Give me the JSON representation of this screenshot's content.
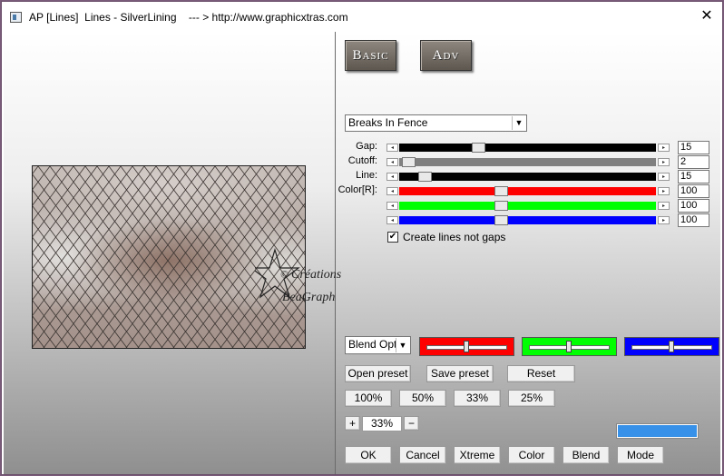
{
  "window": {
    "title": "AP [Lines]  Lines - SilverLining    --- > http://www.graphicxtras.com",
    "close_glyph": "✕",
    "app_icon": "window-app-icon"
  },
  "mode_buttons": {
    "basic": "Basic",
    "adv": "Adv"
  },
  "effect_select": {
    "value": "Breaks In Fence"
  },
  "sliders": [
    {
      "label": "Gap:",
      "value": "15",
      "fraction": 0.3,
      "color": "#000000"
    },
    {
      "label": "Cutoff:",
      "value": "2",
      "fraction": 0.01,
      "color": "#808080"
    },
    {
      "label": "Line:",
      "value": "15",
      "fraction": 0.08,
      "color": "#000000"
    },
    {
      "label": "Color[R]:",
      "value": "100",
      "fraction": 0.39,
      "color": "#ff0000"
    },
    {
      "label": "",
      "value": "100",
      "fraction": 0.39,
      "color": "#00ff00"
    },
    {
      "label": "",
      "value": "100",
      "fraction": 0.39,
      "color": "#0000ff"
    }
  ],
  "checkbox": {
    "label": "Create lines not gaps",
    "checked": true,
    "mark": "✔"
  },
  "blend_select": {
    "value": "Blend Opti"
  },
  "color_sliders": [
    {
      "color": "#ff0000",
      "fraction": 0.48
    },
    {
      "color": "#00ff00",
      "fraction": 0.48
    },
    {
      "color": "#0000ff",
      "fraction": 0.48
    }
  ],
  "preset_buttons": {
    "open": "Open preset",
    "save": "Save preset",
    "reset": "Reset"
  },
  "zoom_buttons": [
    "100%",
    "50%",
    "33%",
    "25%"
  ],
  "zoom": {
    "plus": "+",
    "value": "33%",
    "minus": "−"
  },
  "swatch": {
    "color": "#3891e8"
  },
  "action_buttons": [
    "OK",
    "Cancel",
    "Xtreme",
    "Color",
    "Blend",
    "Mode"
  ],
  "watermark": {
    "line1": "Créations",
    "line2": "BeaGraph",
    "copyright": "©"
  }
}
